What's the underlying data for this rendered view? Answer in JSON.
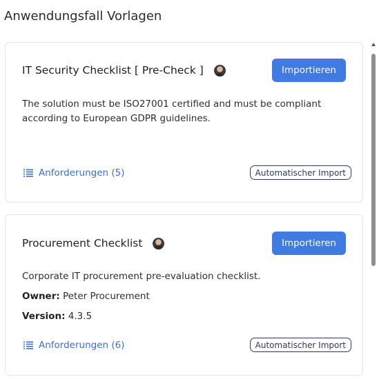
{
  "page": {
    "title": "Anwendungsfall Vorlagen"
  },
  "cards": [
    {
      "title": "IT Security Checklist [ Pre-Check ]",
      "import_label": "Importieren",
      "description": "The solution must be ISO27001 certified and must be compliant according to European GDPR guidelines.",
      "requirements_label": "Anforderungen (5)",
      "badge": "Automatischer Import"
    },
    {
      "title": "Procurement Checklist",
      "import_label": "Importieren",
      "description": "Corporate IT procurement pre-evaluation checklist.",
      "owner_label": "Owner:",
      "owner_value": "Peter Procurement",
      "version_label": "Version:",
      "version_value": "4.3.5",
      "requirements_label": "Anforderungen (6)",
      "badge": "Automatischer Import"
    }
  ],
  "icons": {
    "avatar": "user-avatar",
    "requirements": "list-icon"
  },
  "colors": {
    "accent": "#3f7be0",
    "link": "#3a6fd0",
    "badge_border": "#2f3b52"
  }
}
